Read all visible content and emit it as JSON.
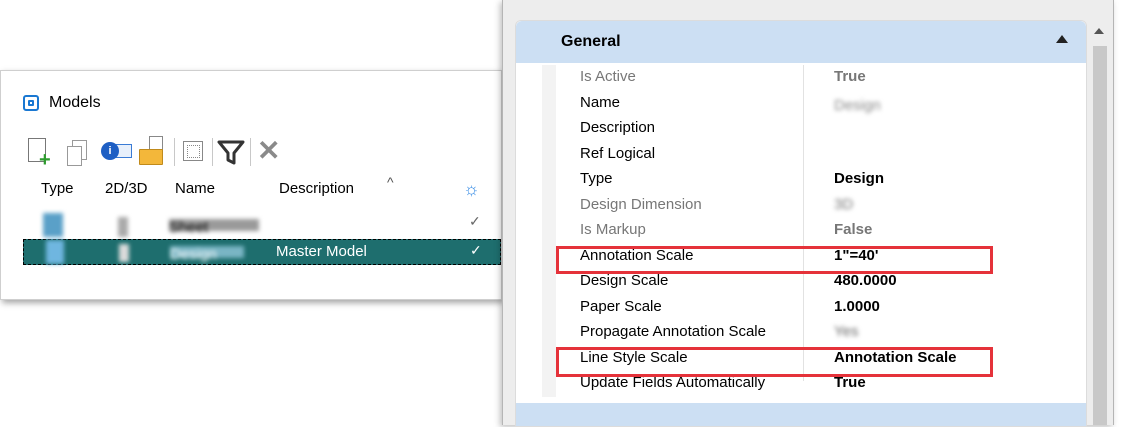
{
  "models": {
    "title": "Models",
    "columns": {
      "type": "Type",
      "dim": "2D/3D",
      "name": "Name",
      "description": "Description"
    },
    "rows": [
      {
        "name": "Sheet",
        "description": "",
        "check": "✓"
      },
      {
        "name": "Design",
        "description": "Master Model",
        "check": "✓"
      }
    ]
  },
  "general": {
    "title": "General",
    "properties": [
      {
        "name": "Is Active",
        "value": "True"
      },
      {
        "name": "Name",
        "value": "Design"
      },
      {
        "name": "Description",
        "value": ""
      },
      {
        "name": "Ref Logical",
        "value": ""
      },
      {
        "name": "Type",
        "value": "Design"
      },
      {
        "name": "Design Dimension",
        "value": "3D"
      },
      {
        "name": "Is Markup",
        "value": "False"
      },
      {
        "name": "Annotation Scale",
        "value": "1\"=40'"
      },
      {
        "name": "Design Scale",
        "value": "480.0000"
      },
      {
        "name": "Paper Scale",
        "value": "1.0000"
      },
      {
        "name": "Propagate Annotation Scale",
        "value": "Yes"
      },
      {
        "name": "Line Style Scale",
        "value": "Annotation Scale"
      },
      {
        "name": "Update Fields Automatically",
        "value": "True"
      }
    ]
  },
  "colors": {
    "highlight": "#e5323a",
    "selected_row": "#1e6e6e",
    "group_header": "#ccdff3"
  }
}
